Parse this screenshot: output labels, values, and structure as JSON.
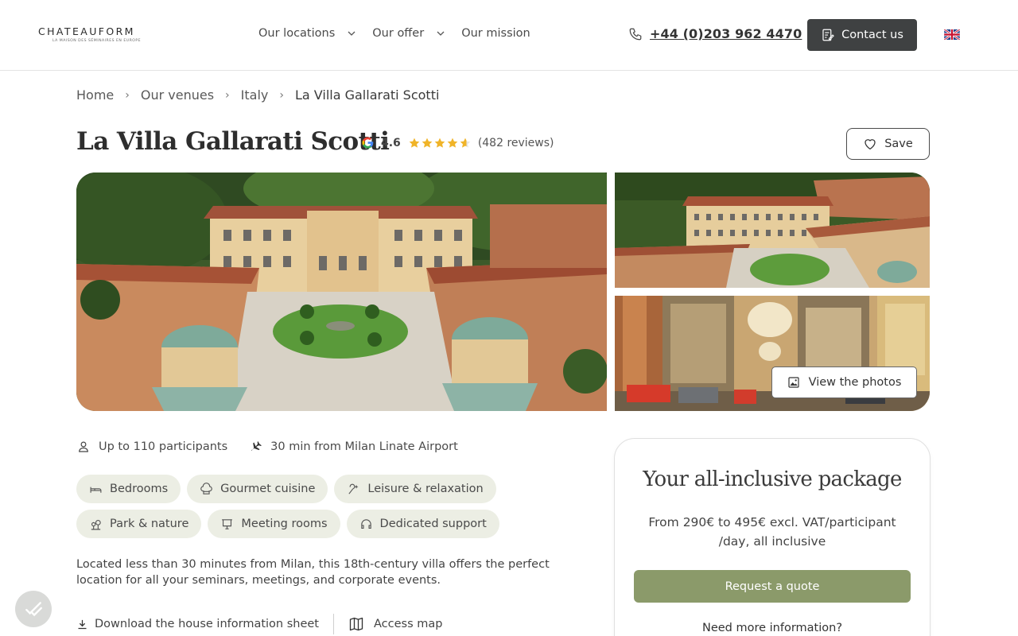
{
  "header": {
    "logo": {
      "name": "CHATEAUFORM",
      "tagline": "LA MAISON DES SÉMINAIRES EN EUROPE"
    },
    "nav": [
      {
        "label": "Our locations",
        "has_dropdown": true
      },
      {
        "label": "Our offer",
        "has_dropdown": true
      },
      {
        "label": "Our mission",
        "has_dropdown": false
      }
    ],
    "phone": "+44 (0)203 962 4470",
    "contact_label": "Contact us",
    "language_flag": "uk-flag-icon"
  },
  "breadcrumb": [
    "Home",
    "Our venues",
    "Italy",
    "La Villa Gallarati Scotti"
  ],
  "venue": {
    "title": "La Villa Gallarati Scotti",
    "rating": "4.6",
    "stars": 4.6,
    "reviews": "(482 reviews)",
    "save_label": "Save"
  },
  "gallery": {
    "view_photos_label": "View the photos"
  },
  "facts": {
    "participants": "Up to 110 participants",
    "airport": "30 min from Milan Linate Airport"
  },
  "features": [
    {
      "label": "Bedrooms",
      "icon": "bed-icon"
    },
    {
      "label": "Gourmet cuisine",
      "icon": "chef-hat-icon"
    },
    {
      "label": "Leisure & relaxation",
      "icon": "sparkle-icon"
    },
    {
      "label": "Park & nature",
      "icon": "tree-icon"
    },
    {
      "label": "Meeting rooms",
      "icon": "presentation-icon"
    },
    {
      "label": "Dedicated support",
      "icon": "headset-icon"
    }
  ],
  "description": "Located less than 30 minutes from Milan, this 18th-century villa offers the perfect location for all your seminars, meetings, and corporate events.",
  "links": {
    "download_label": "Download the house information sheet",
    "map_label": "Access map"
  },
  "package": {
    "title": "Your all-inclusive package",
    "price": "From 290€ to 495€ excl. VAT/participant /day, all inclusive",
    "quote_label": "Request a quote",
    "more_info": "Need more information?"
  },
  "colors": {
    "accent_green": "#8b9a6a",
    "chip_bg": "#eceee4",
    "dark_button": "#3f4142",
    "star": "#f0b429"
  }
}
